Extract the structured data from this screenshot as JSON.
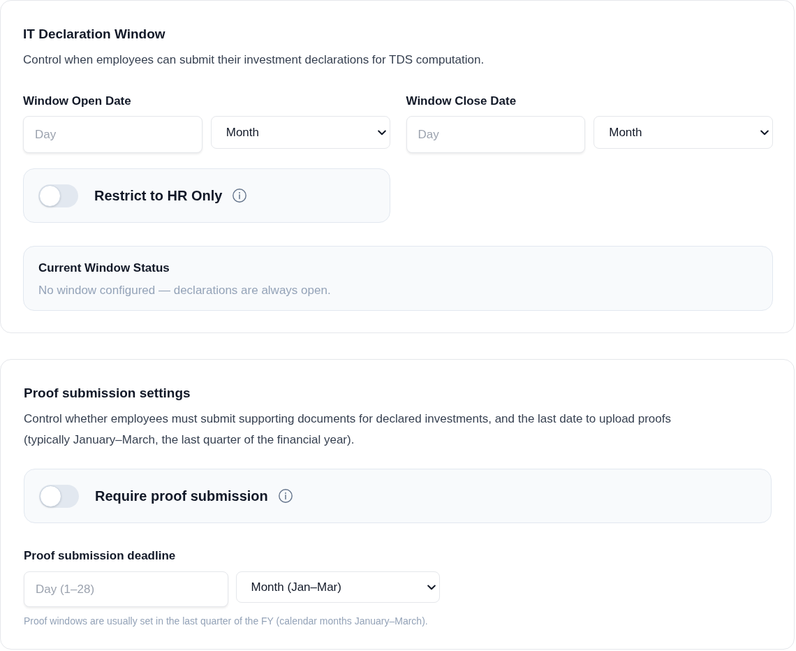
{
  "it_declaration_window": {
    "title": "IT Declaration Window",
    "description": "Control when employees can submit their investment declarations for TDS computation.",
    "date_fields": [
      {
        "label": "Window Open Date",
        "day": {
          "placeholder": "Day"
        },
        "month": {
          "value": "Month"
        }
      },
      {
        "label": "Window Close Date",
        "day": {
          "placeholder": "Day"
        },
        "month": {
          "value": "Month"
        }
      }
    ],
    "toggle": {
      "label": "Restrict to HR Only",
      "on": false
    },
    "status": {
      "title": "Current Window Status",
      "text": "No window configured — declarations are always open."
    }
  },
  "proof_submission_settings": {
    "title": "Proof submission settings",
    "description": "Control whether employees must submit supporting documents for declared investments, and the last date to upload proofs (typically January–March, the last quarter of the financial year).",
    "toggle": {
      "label": "Require proof submission",
      "on": false
    },
    "deadline": {
      "label": "Proof submission deadline",
      "day": {
        "placeholder": "Day (1–28)"
      },
      "month": {
        "value": "Month (Jan–Mar)"
      },
      "hint": "Proof windows are usually set in the last quarter of the FY (calendar months January–March)."
    }
  }
}
